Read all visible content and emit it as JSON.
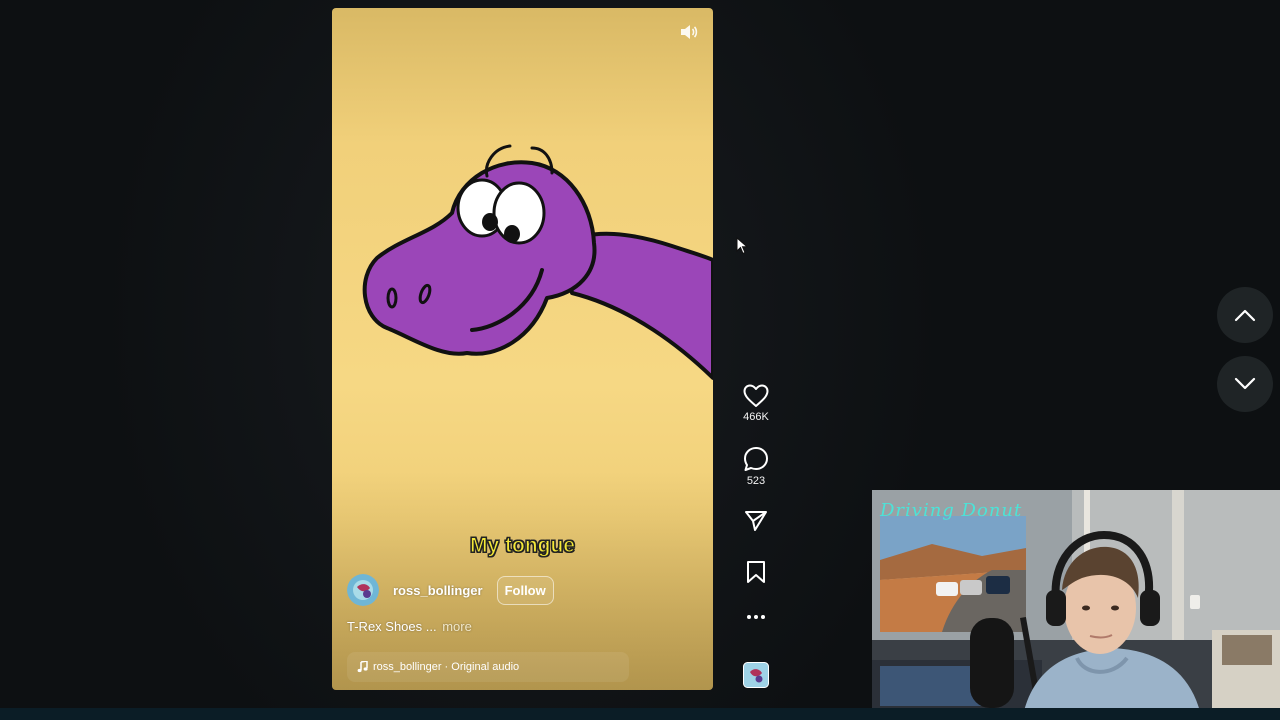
{
  "reel": {
    "caption": "My tongue",
    "username": "ross_bollinger",
    "follow_label": "Follow",
    "description": "T-Rex Shoes ...",
    "more_label": "more",
    "audio_text": "ross_bollinger · Original audio"
  },
  "actions": {
    "likes": "466K",
    "comments": "523"
  },
  "webcam": {
    "overlay_title": "Driving Donut"
  },
  "colors": {
    "caption_yellow": "#f4e838",
    "dino_purple": "#9b46b8",
    "background_yellow": "#f6d884",
    "page_bg": "#0f1214"
  },
  "icons": [
    "volume-icon",
    "heart-icon",
    "comment-icon",
    "share-icon",
    "bookmark-icon",
    "more-icon",
    "chevron-up-icon",
    "chevron-down-icon",
    "music-note-icon"
  ]
}
